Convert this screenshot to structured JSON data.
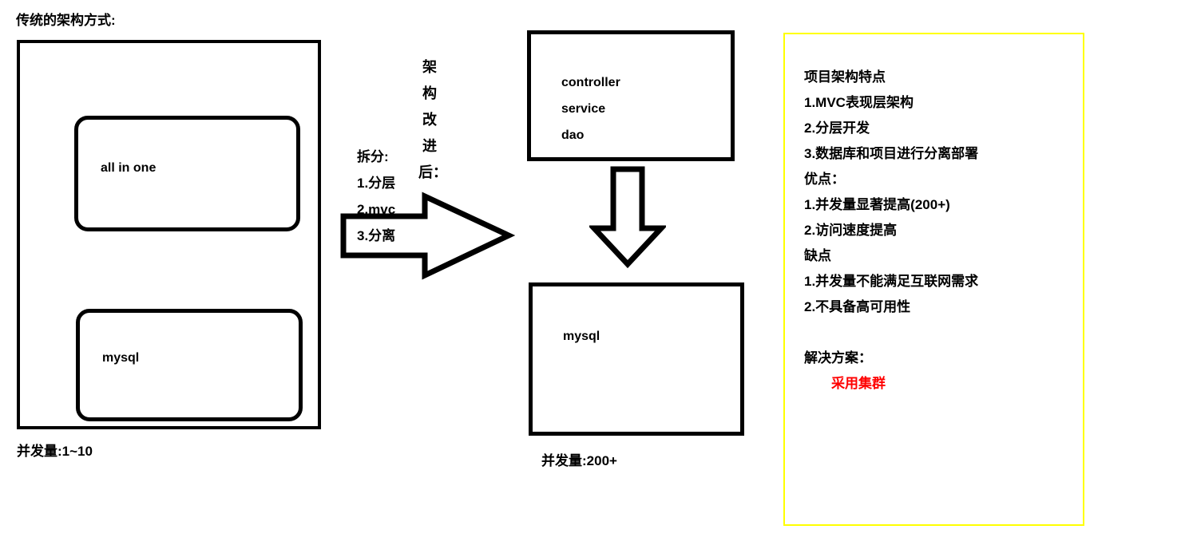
{
  "legacy": {
    "title": "传统的架构方式:",
    "boxes": [
      {
        "label": "all in one"
      },
      {
        "label": "mysql"
      }
    ],
    "caption": "并发量:1~10"
  },
  "transition": {
    "vertical_label_chars": [
      "架",
      "构",
      "改",
      "进",
      "后："
    ],
    "split_heading": "拆分:",
    "split_items": [
      "1.分层",
      "2.mvc",
      "3.分离"
    ],
    "arrow_right_name": "arrow-right-icon",
    "arrow_down_name": "arrow-down-icon"
  },
  "improved": {
    "layers": [
      "controller",
      "service",
      "dao"
    ],
    "db_label": "mysql",
    "caption": "并发量:200+"
  },
  "notes": {
    "lines": [
      {
        "text": "项目架构特点",
        "style": "plain"
      },
      {
        "text": "1.MVC表现层架构",
        "style": "plain"
      },
      {
        "text": "2.分层开发",
        "style": "plain"
      },
      {
        "text": "3.数据库和项目进行分离部署",
        "style": "plain"
      },
      {
        "text": "优点：",
        "style": "plain"
      },
      {
        "text": "1.并发量显著提高(200+)",
        "style": "plain"
      },
      {
        "text": "2.访问速度提高",
        "style": "plain"
      },
      {
        "text": "缺点",
        "style": "plain"
      },
      {
        "text": "1.并发量不能满足互联网需求",
        "style": "plain"
      },
      {
        "text": "2.不具备高可用性",
        "style": "plain"
      },
      {
        "text": " ",
        "style": "plain"
      },
      {
        "text": "解决方案：",
        "style": "plain"
      },
      {
        "text": "采用集群",
        "style": "accent-indent"
      }
    ]
  },
  "colors": {
    "stroke": "#000000",
    "notes_border": "#ffff00",
    "accent": "#ff0000",
    "background": "#ffffff"
  }
}
